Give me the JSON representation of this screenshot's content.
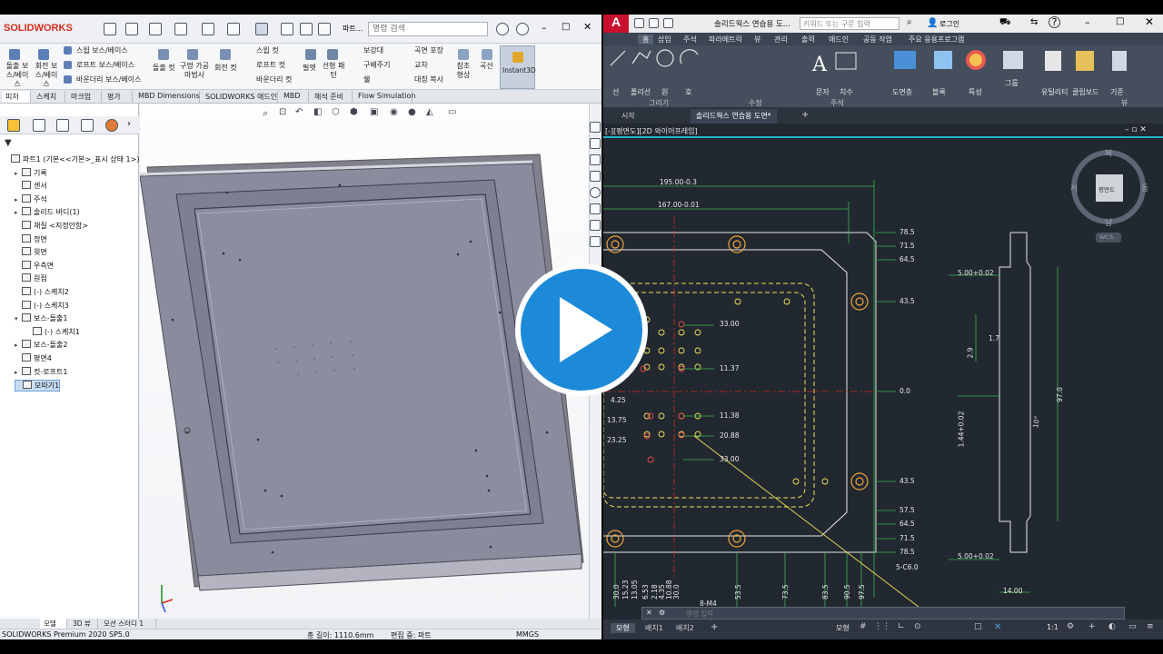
{
  "solidworks": {
    "brand": "SOLIDWORKS",
    "search_placeholder": "명령 검색",
    "file_menu": "파트...",
    "ribbon": {
      "extrude_boss": "돌출 보스/베이스",
      "revolve_boss": "회전 보스/베이스",
      "sweep_boss": "스윕 보스/베이스",
      "loft_boss": "로프트 보스/베이스",
      "boundary_boss": "바운더리 보스/베이스",
      "extrude_cut": "돌출 컷",
      "hole_wizard": "구멍 가공 마법사",
      "revolve_cut": "회전 컷",
      "sweep_cut": "스윕 컷",
      "loft_cut": "로프트 컷",
      "boundary_cut": "바운더리 컷",
      "fillet": "필렛",
      "linear_pattern": "선형 패턴",
      "rib": "보강대",
      "draft": "구배주기",
      "shell": "쉘",
      "wrap": "곡면 포장",
      "intersect": "교차",
      "mirror": "대칭 복사",
      "reference_geometry": "참조 형상",
      "curves": "곡선",
      "instant3d": "Instant3D"
    },
    "tabs": [
      "피처",
      "스케치",
      "마크업",
      "평가",
      "MBD Dimensions",
      "SOLIDWORKS 애드인",
      "MBD",
      "해석 준비",
      "Flow Simulation"
    ],
    "tree": [
      {
        "label": "파트1  (기본<<기본>_표시 상태 1>)",
        "indent": 0,
        "expand": ""
      },
      {
        "label": "기록",
        "indent": 1,
        "expand": "▸"
      },
      {
        "label": "센서",
        "indent": 1,
        "expand": ""
      },
      {
        "label": "주석",
        "indent": 1,
        "expand": "▸"
      },
      {
        "label": "솔리드 바디(1)",
        "indent": 1,
        "expand": "▸"
      },
      {
        "label": "재질 <지정안함>",
        "indent": 1,
        "expand": ""
      },
      {
        "label": "정면",
        "indent": 1,
        "expand": ""
      },
      {
        "label": "윗면",
        "indent": 1,
        "expand": ""
      },
      {
        "label": "우측면",
        "indent": 1,
        "expand": ""
      },
      {
        "label": "원점",
        "indent": 1,
        "expand": ""
      },
      {
        "label": "(-) 스케치2",
        "indent": 1,
        "expand": ""
      },
      {
        "label": "(-) 스케치3",
        "indent": 1,
        "expand": ""
      },
      {
        "label": "보스-돌출1",
        "indent": 1,
        "expand": "▾"
      },
      {
        "label": "(-) 스케치1",
        "indent": 2,
        "expand": ""
      },
      {
        "label": "보스-돌출2",
        "indent": 1,
        "expand": "▸"
      },
      {
        "label": "평면4",
        "indent": 1,
        "expand": ""
      },
      {
        "label": "컷-로프트1",
        "indent": 1,
        "expand": "▸"
      },
      {
        "label": "모따기1",
        "indent": 1,
        "expand": ""
      }
    ],
    "bottom_tabs": [
      "모델",
      "3D 뷰",
      "모션 스터디 1"
    ],
    "status": {
      "product": "SOLIDWORKS Premium 2020 SP5.0",
      "length": "총 길이: 1110.6mm",
      "editing": "편집 중: 파트",
      "units": "MMGS"
    }
  },
  "autocad": {
    "title": "솔리드웍스 연습용 도...",
    "search_placeholder": "키워드 또는 구문 입력",
    "login": "로그인",
    "menu": [
      "홈",
      "삽입",
      "주석",
      "파라메트릭",
      "뷰",
      "관리",
      "출력",
      "애드인",
      "공동 작업",
      "주요 응용프로그램"
    ],
    "ribbon": {
      "line": "선",
      "polyline": "폴리선",
      "circle": "원",
      "arc": "호",
      "text": "문자",
      "dimension": "치수",
      "layers": "도면층",
      "block": "블록",
      "properties": "특성",
      "groups": "그룹",
      "utilities": "유틸리티",
      "clipboard": "클립보드",
      "base": "기준",
      "draw_panel": "그리기",
      "modify_panel": "수정",
      "annotation_panel": "주석",
      "view_panel": "뷰"
    },
    "doc_tabs": [
      "시작",
      "솔리드웍스 연습용 도면*"
    ],
    "viewport_label": "[-][평면도][2D 와이어프레임]",
    "viewcube": {
      "top": "평면도",
      "n": "북",
      "s": "남",
      "e": "동",
      "w": "서",
      "wcs": "WCS"
    },
    "dims_top": [
      "195.00-0.3",
      "167.00-0.01"
    ],
    "dims_right": [
      "78.5",
      "71.5",
      "64.5",
      "43.5",
      "0.0",
      "43.5",
      "57.5",
      "64.5",
      "71.5",
      "78.5"
    ],
    "dims_inner": [
      "33.00",
      "11.37",
      "11.38",
      "20.88",
      "33.00"
    ],
    "dims_left": [
      "4.25",
      "13.75",
      "23.25"
    ],
    "dims_bottom": [
      "30.0",
      "15.23",
      "13.05",
      "6.53",
      "2.18",
      "4.35",
      "10.88",
      "30.0",
      "53.5",
      "73.5",
      "83.5",
      "90.5",
      "97.5"
    ],
    "section_dims": [
      "5.00+0.02",
      "1.7",
      "2.9",
      "97.0",
      "10°",
      "1.44+0.02",
      "5.00+0.02",
      "14.00"
    ],
    "chamfer_note": "5-C6.0",
    "thread_note": "8-M4",
    "command_placeholder": "명령 입력",
    "layout_tabs": [
      "모형",
      "배치1",
      "배치2"
    ],
    "status_mode": "모형",
    "scale": "1:1"
  }
}
